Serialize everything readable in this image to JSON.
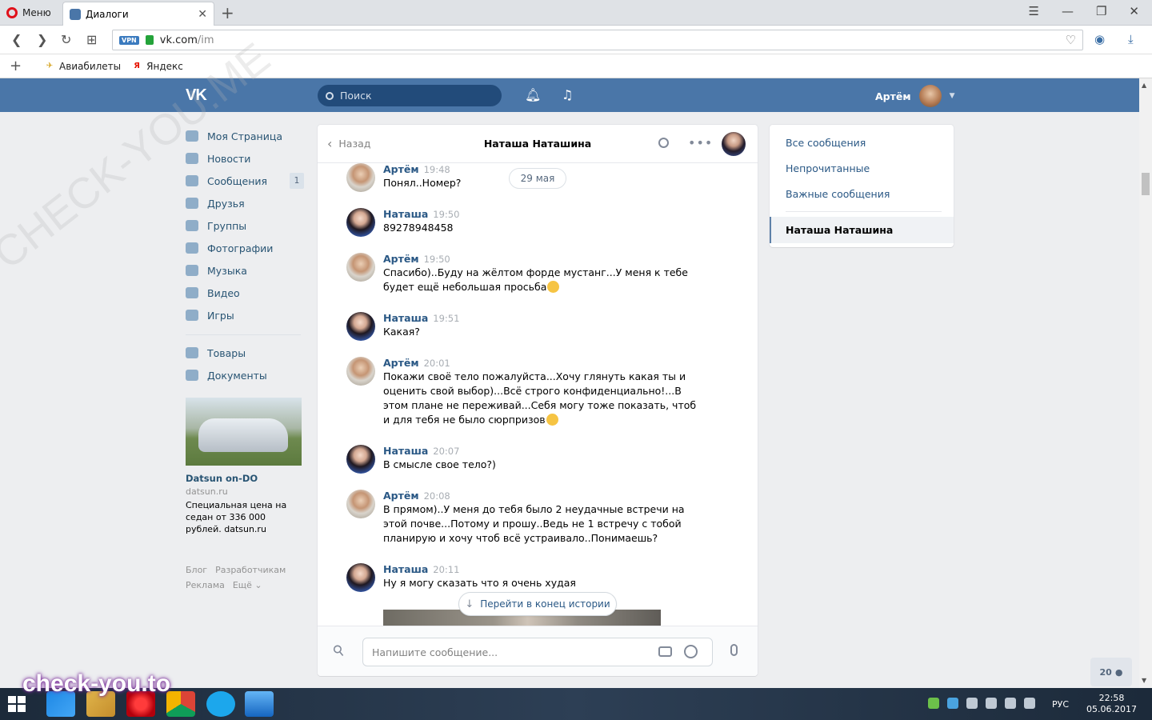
{
  "browser": {
    "menu_label": "Меню",
    "tab_title": "Диалоги",
    "url_domain": "vk.com",
    "url_path": "/im",
    "vpn_badge": "VPN",
    "bookmarks": [
      {
        "label": "Авиабилеты"
      },
      {
        "label": "Яндекс"
      }
    ]
  },
  "vk_header": {
    "logo": "VK",
    "search_placeholder": "Поиск",
    "user_name": "Артём"
  },
  "leftnav": {
    "items": [
      {
        "label": "Моя Страница"
      },
      {
        "label": "Новости"
      },
      {
        "label": "Сообщения",
        "badge": "1"
      },
      {
        "label": "Друзья"
      },
      {
        "label": "Группы"
      },
      {
        "label": "Фотографии"
      },
      {
        "label": "Музыка"
      },
      {
        "label": "Видео"
      },
      {
        "label": "Игры"
      }
    ],
    "items2": [
      {
        "label": "Товары"
      },
      {
        "label": "Документы"
      }
    ],
    "ad": {
      "title": "Datsun on-DO",
      "domain": "datsun.ru",
      "text": "Специальная цена на седан от 336 000 рублей. datsun.ru"
    },
    "footer": [
      "Блог",
      "Разработчикам",
      "Реклама",
      "Ещё ⌄"
    ]
  },
  "chat": {
    "back_label": "Назад",
    "title": "Наташа Наташина",
    "date_pill": "29 мая",
    "messages": [
      {
        "author": "Артём",
        "time": "19:48",
        "text": "Понял..Номер?"
      },
      {
        "author": "Наташа",
        "time": "19:50",
        "text": "89278948458"
      },
      {
        "author": "Артём",
        "time": "19:50",
        "text": "Спасибо)..Буду на жёлтом форде мустанг...У меня к тебе будет ещё небольшая просьба"
      },
      {
        "author": "Наташа",
        "time": "19:51",
        "text": "Какая?"
      },
      {
        "author": "Артём",
        "time": "20:01",
        "text": "Покажи своё тело пожалуйста...Хочу глянуть какая ты и оценить свой выбор)...Всё строго конфиденциально!...В этом плане не переживай...Себя могу тоже показать, чтоб и для тебя не было сюрпризов"
      },
      {
        "author": "Наташа",
        "time": "20:07",
        "text": "В смысле свое тело?)"
      },
      {
        "author": "Артём",
        "time": "20:08",
        "text": "В прямом)..У меня до тебя было 2 неудачные встречи на этой почве...Потому и прошу..Ведь не 1 встречу с тобой планирую и хочу чтоб всё устраивало..Понимаешь?"
      },
      {
        "author": "Наташа",
        "time": "20:11",
        "text": "Ну я могу сказать что я очень худая"
      }
    ],
    "jump_label": "Перейти в конец истории",
    "input_placeholder": "Напишите сообщение..."
  },
  "rightpanel": {
    "items": [
      {
        "label": "Все сообщения"
      },
      {
        "label": "Непрочитанные"
      },
      {
        "label": "Важные сообщения"
      }
    ],
    "active": "Наташа Наташина"
  },
  "counter": "20",
  "watermarks": {
    "diagonal": "CHECK-YOU.ME",
    "bottom": "check-you.to"
  },
  "taskbar": {
    "lang": "РУС",
    "time": "22:58",
    "date": "05.06.2017"
  },
  "colors": {
    "vk_blue": "#4a76a8",
    "link": "#2a5885",
    "background": "#edeef0"
  }
}
